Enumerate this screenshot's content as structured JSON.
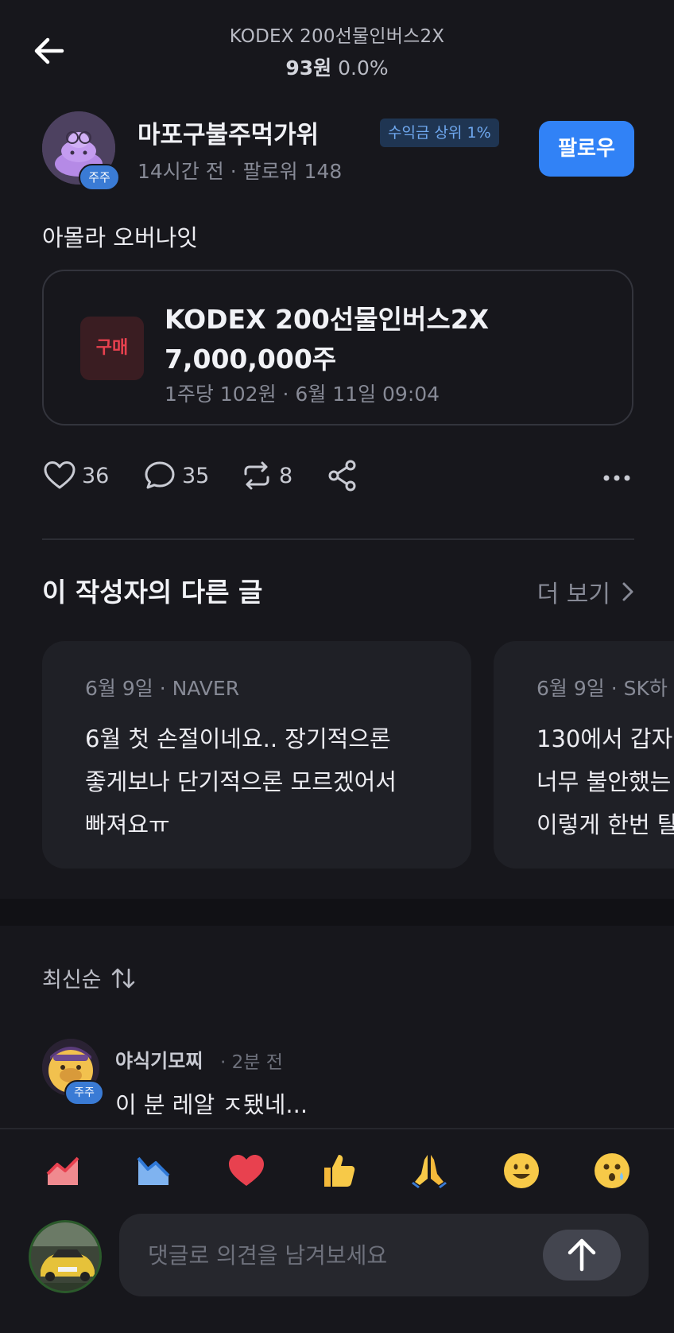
{
  "header": {
    "stock_name": "KODEX 200선물인버스2X",
    "price": "93원",
    "change": "0.0%"
  },
  "author": {
    "name": "마포구불주먹가위",
    "rank_badge": "수익금 상위 1%",
    "avatar_badge": "주주",
    "meta": "14시간 전 · 팔로워 148",
    "follow_label": "팔로우"
  },
  "post": {
    "text": "아몰라 오버나잇"
  },
  "trade": {
    "type_label": "구매",
    "stock": "KODEX 200선물인버스2X",
    "quantity": "7,000,000주",
    "meta": "1주당 102원 · 6월 11일 09:04"
  },
  "actions": {
    "likes": "36",
    "comments": "35",
    "reposts": "8"
  },
  "other_posts": {
    "title": "이 작성자의 다른 글",
    "more_label": "더 보기",
    "cards": [
      {
        "meta": "6월 9일 · NAVER",
        "lines": [
          "6월 첫 손절이네요.. 장기적으론",
          "좋게보나 단기적으론 모르겠어서",
          "빠져요ㅠ"
        ]
      },
      {
        "meta": "6월 9일 · SK하",
        "lines": [
          "130에서 갑자",
          "너무 불안했는",
          "이렇게 한번 탈"
        ]
      }
    ]
  },
  "comments": {
    "sort_label": "최신순",
    "items": [
      {
        "name": "야식기모찌",
        "time": "· 2분 전",
        "badge": "주주",
        "text": "이 분 레알 ㅈ됐네..."
      }
    ]
  },
  "composer": {
    "placeholder": "댓글로 의견을 남겨보세요",
    "reactions": [
      "chart-up-icon",
      "chart-down-icon",
      "heart-icon",
      "thumbs-up-icon",
      "pray-icon",
      "smile-icon",
      "surprised-icon"
    ]
  },
  "colors": {
    "background": "#17171c",
    "accent": "#3182f6",
    "buy_red": "#e8414f",
    "badge_blue": "#6fa8ef"
  }
}
